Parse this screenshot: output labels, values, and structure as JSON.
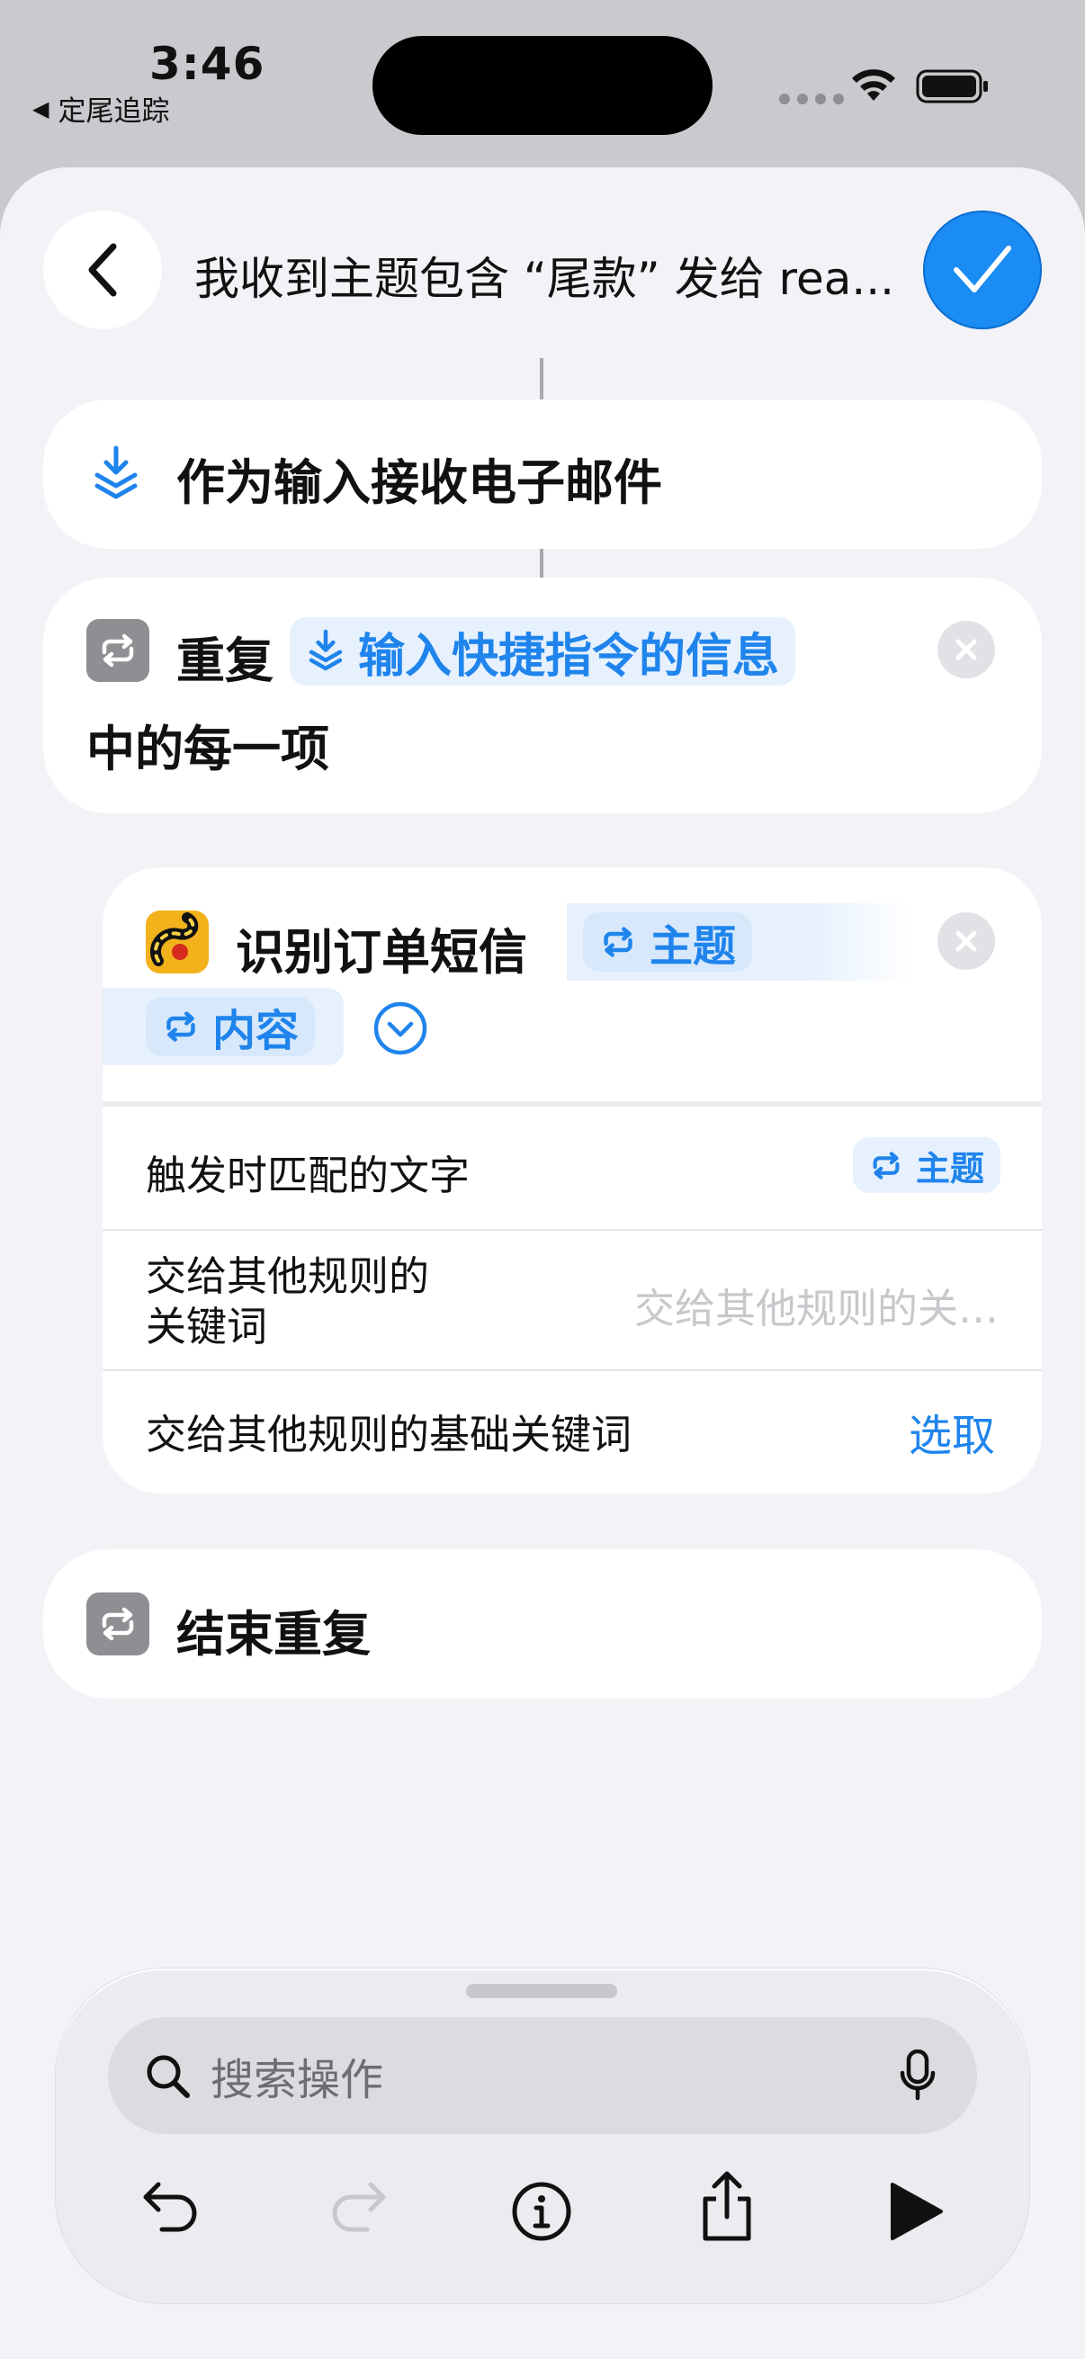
{
  "status_bar": {
    "time": "3:46",
    "back_app": "定尾追踪",
    "back_arrow": "◀"
  },
  "header": {
    "title": "我收到主题包含 “尾款” 发给 rea..."
  },
  "receive_email": {
    "label": "作为输入接收电子邮件"
  },
  "repeat": {
    "keyword": "重复",
    "token": "输入快捷指令的信息",
    "suffix": "中的每一项"
  },
  "identify": {
    "title": "识别订单短信",
    "token_subject": "主题",
    "token_content": "内容",
    "rows": [
      {
        "label": "触发时匹配的文字",
        "value": "主题"
      },
      {
        "label_line1": "交给其他规则的",
        "label_line2": "关键词",
        "placeholder": "交给其他规则的关…"
      },
      {
        "label": "交给其他规则的基础关键词",
        "action": "选取"
      }
    ]
  },
  "end_repeat": {
    "label": "结束重复"
  },
  "bottom": {
    "search_placeholder": "搜索操作"
  },
  "colors": {
    "accent": "#1f84ec",
    "done_button": "#1a8cf3",
    "sheet": "#f2f2f7",
    "card": "#ffffff"
  }
}
